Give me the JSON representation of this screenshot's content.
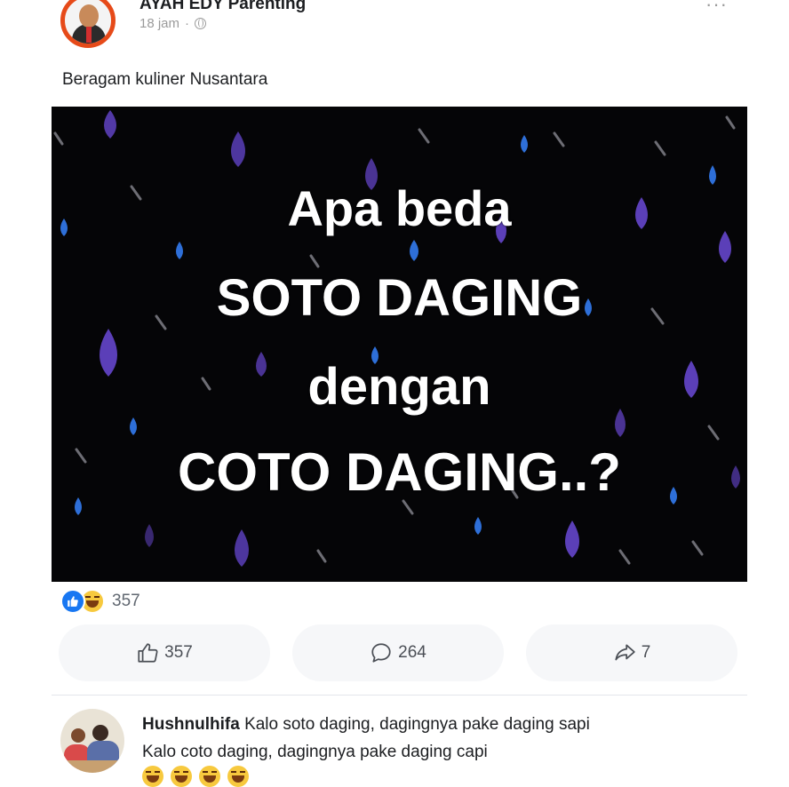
{
  "post": {
    "page_name": "AYAH EDY Parenting",
    "time": "18 jam",
    "separator": "·",
    "more_label": "···",
    "text": "Beragam kuliner Nusantara",
    "image_lines": [
      "Apa beda",
      "SOTO DAGING",
      "dengan",
      "COTO DAGING..?"
    ]
  },
  "reactions": {
    "icons": [
      "like-icon",
      "haha-icon"
    ],
    "count": "357"
  },
  "actions": {
    "like_count": "357",
    "comment_count": "264",
    "share_count": "7"
  },
  "comment": {
    "author": "Hushnulhifa",
    "line1": "Kalo soto daging, dagingnya pake daging sapi",
    "line2": "Kalo coto daging, dagingnya pake daging capi"
  },
  "colors": {
    "accent": "#1877f2",
    "image_bg": "#050507",
    "drop_purple": "#5b3fb8",
    "drop_blue": "#2e6fd8"
  }
}
